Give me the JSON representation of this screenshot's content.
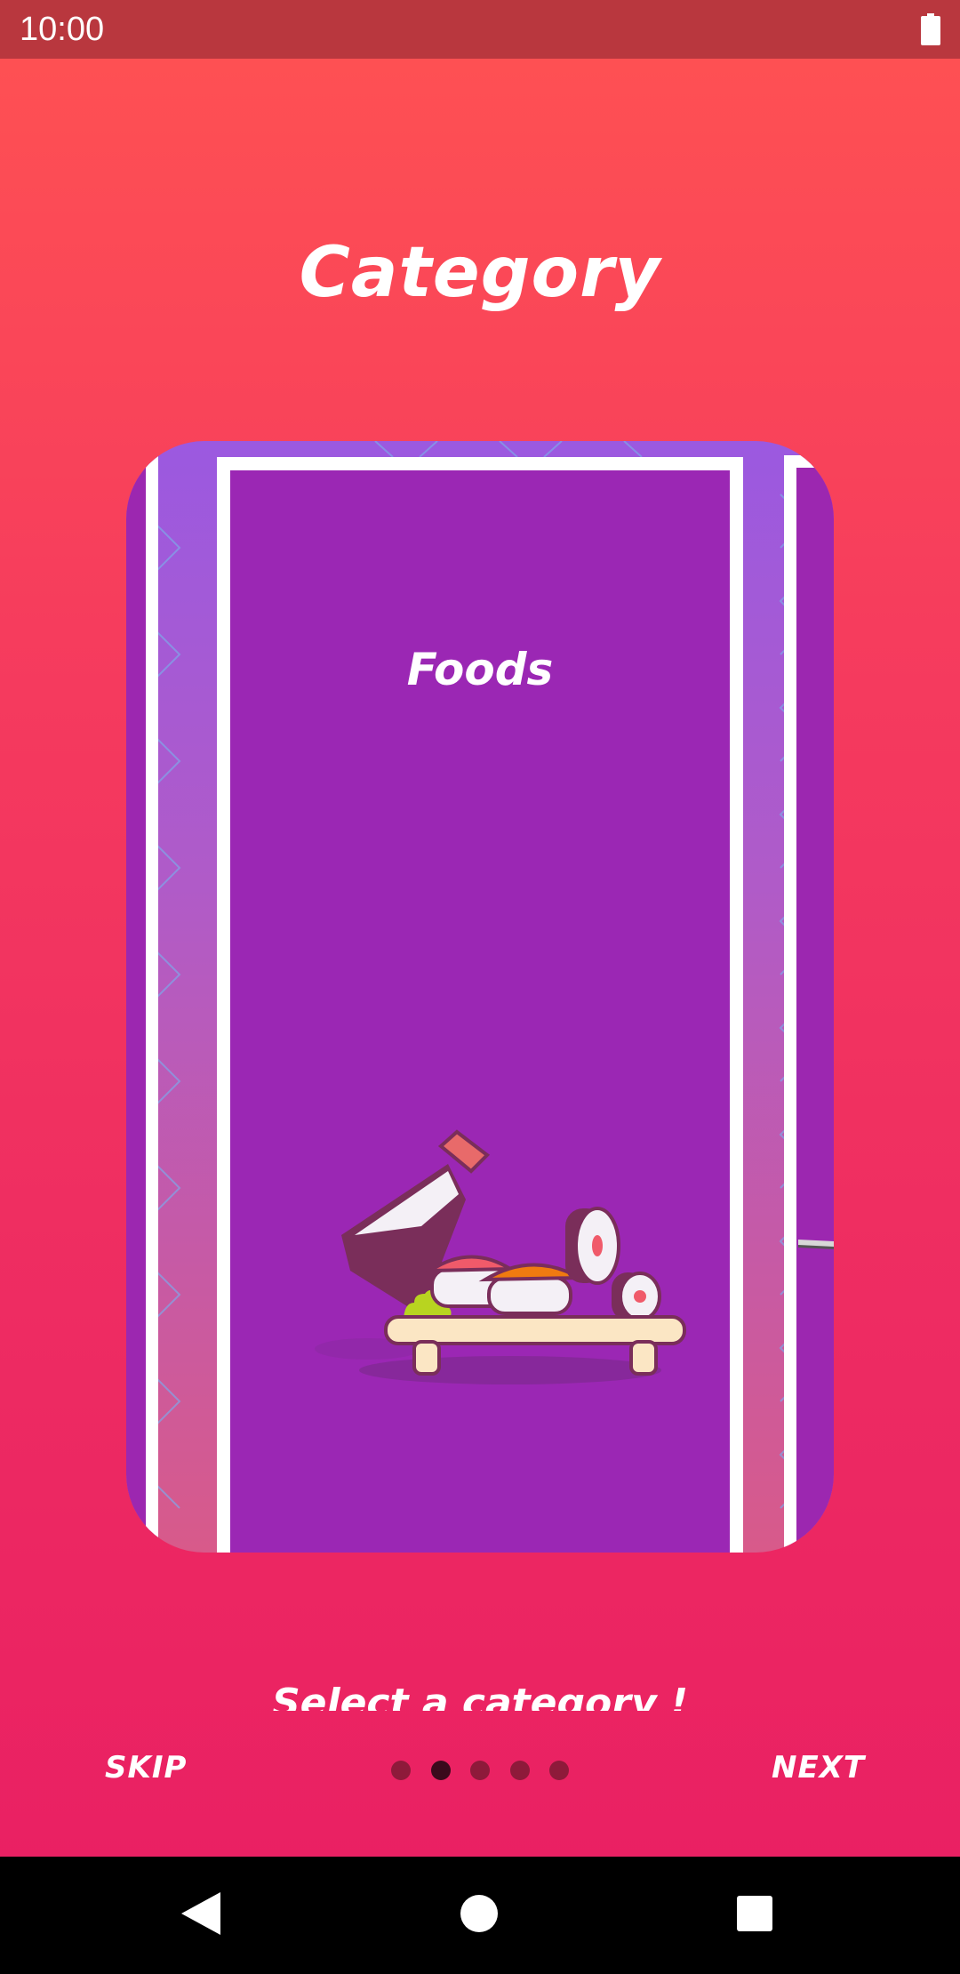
{
  "status_bar": {
    "time": "10:00",
    "battery_icon": "battery-full-icon"
  },
  "header": {
    "title": "Category"
  },
  "carousel": {
    "current_card": {
      "title": "Foods",
      "illustration": "sushi-illustration"
    }
  },
  "footer": {
    "subtitle": "Select a category !",
    "skip_label": "SKIP",
    "next_label": "NEXT",
    "page_count": 5,
    "active_page": 2
  },
  "nav_bar": {
    "back_icon": "back-triangle-icon",
    "home_icon": "home-circle-icon",
    "recents_icon": "recents-square-icon"
  },
  "colors": {
    "background_top": "#ff5252",
    "background_bottom": "#e91e63",
    "card_purple": "#9b27b4",
    "dot_inactive": "#8e1a3a",
    "dot_active": "#3a0a1c"
  }
}
